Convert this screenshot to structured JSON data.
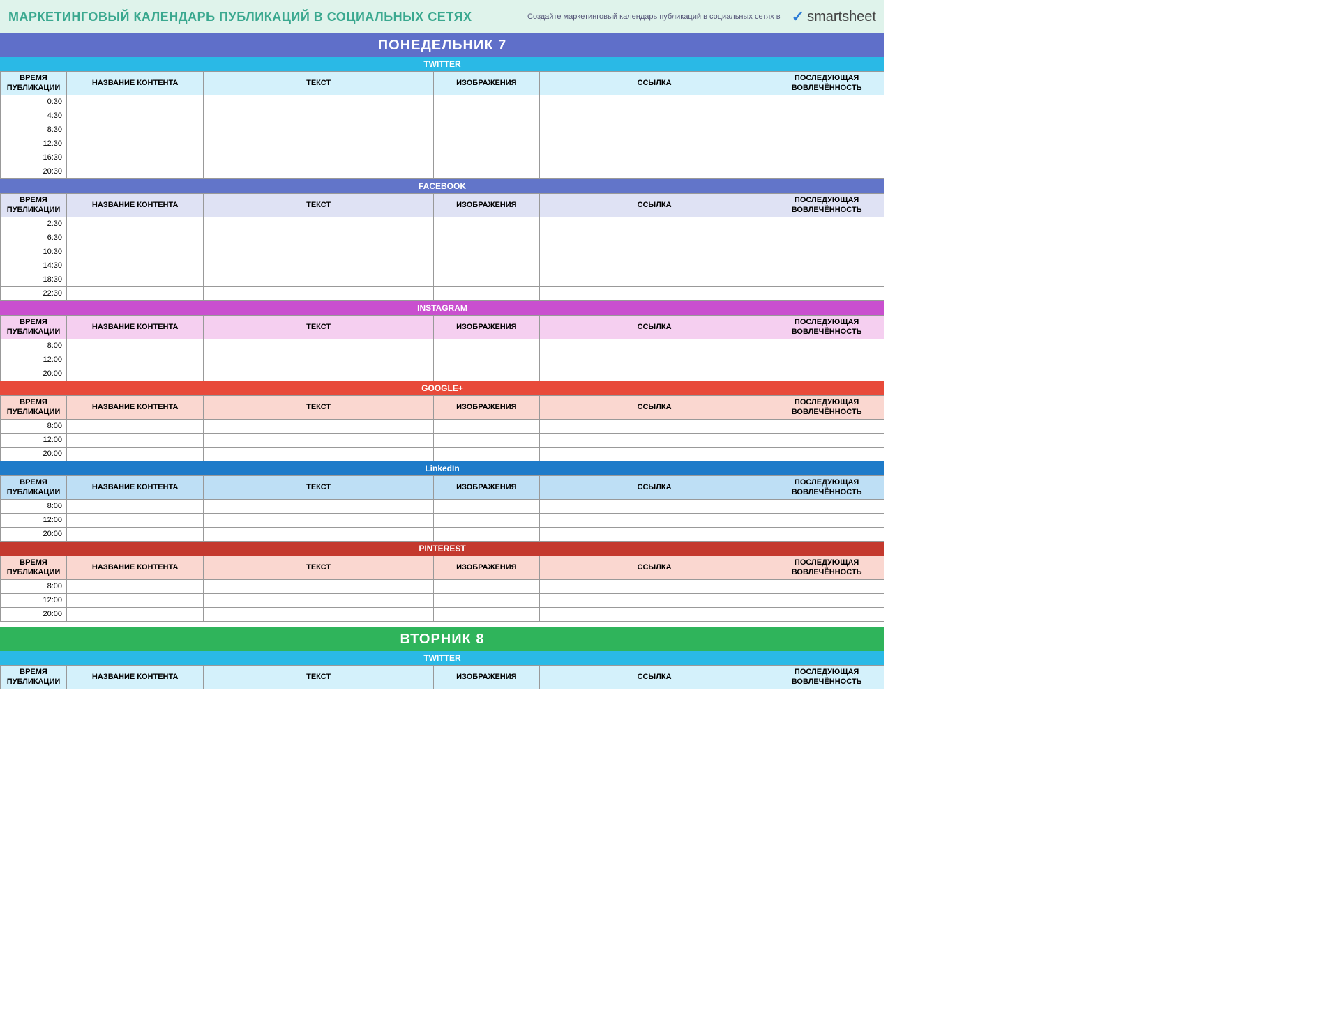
{
  "header": {
    "title": "МАРКЕТИНГОВЫЙ КАЛЕНДАРЬ ПУБЛИКАЦИЙ В СОЦИАЛЬНЫХ СЕТЯХ",
    "create_link": "Создайте маркетинговый календарь публикаций в социальных сетях в",
    "logo_text": "smartsheet"
  },
  "columns": {
    "time": "ВРЕМЯ ПУБЛИКАЦИИ",
    "content": "НАЗВАНИЕ КОНТЕНТА",
    "text": "ТЕКСТ",
    "image": "ИЗОБРАЖЕНИЯ",
    "link": "ССЫЛКА",
    "engage": "ПОСЛЕДУЮЩАЯ ВОВЛЕЧЁННОСТЬ"
  },
  "days": [
    {
      "label": "ПОНЕДЕЛЬНИК   7",
      "bar_class": "blue",
      "networks": [
        {
          "name": "TWITTER",
          "bar_class": "twitter-bar",
          "hdr_class": "hdr-twitter",
          "times": [
            "0:30",
            "4:30",
            "8:30",
            "12:30",
            "16:30",
            "20:30"
          ]
        },
        {
          "name": "FACEBOOK",
          "bar_class": "facebook-bar",
          "hdr_class": "hdr-facebook",
          "times": [
            "2:30",
            "6:30",
            "10:30",
            "14:30",
            "18:30",
            "22:30"
          ]
        },
        {
          "name": "INSTAGRAM",
          "bar_class": "instagram-bar",
          "hdr_class": "hdr-instagram",
          "times": [
            "8:00",
            "12:00",
            "20:00"
          ]
        },
        {
          "name": "GOOGLE+",
          "bar_class": "google-bar",
          "hdr_class": "hdr-google",
          "times": [
            "8:00",
            "12:00",
            "20:00"
          ]
        },
        {
          "name": "LinkedIn",
          "bar_class": "linkedin-bar",
          "hdr_class": "hdr-linkedin",
          "times": [
            "8:00",
            "12:00",
            "20:00"
          ]
        },
        {
          "name": "PINTEREST",
          "bar_class": "pinterest-bar",
          "hdr_class": "hdr-pinterest",
          "times": [
            "8:00",
            "12:00",
            "20:00"
          ]
        }
      ]
    },
    {
      "label": "ВТОРНИК   8",
      "bar_class": "green",
      "networks": [
        {
          "name": "TWITTER",
          "bar_class": "twitter-bar",
          "hdr_class": "hdr-twitter",
          "times": []
        }
      ]
    }
  ]
}
